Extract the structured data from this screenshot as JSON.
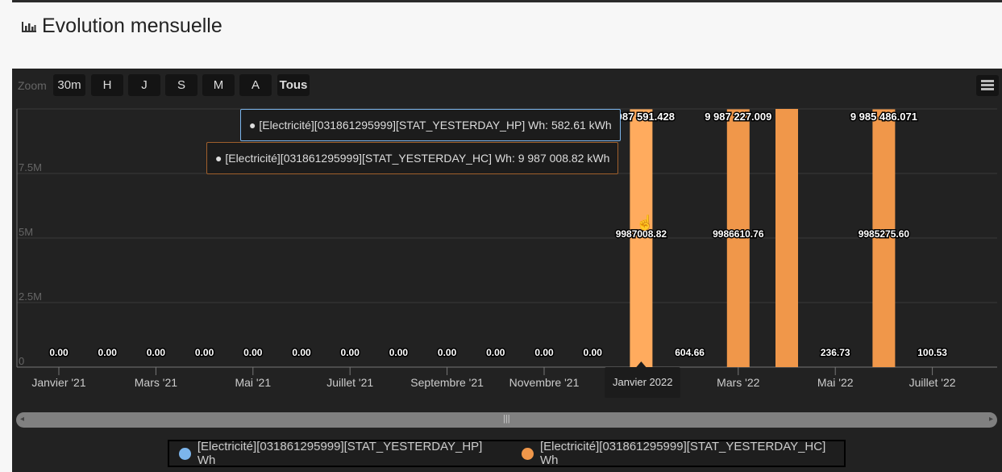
{
  "page": {
    "title": "Evolution mensuelle",
    "title_icon": "bar-chart-icon"
  },
  "toolbar": {
    "zoom_label": "Zoom",
    "buttons": [
      "30m",
      "H",
      "J",
      "S",
      "M",
      "A",
      "Tous"
    ],
    "menu_icon": "hamburger-menu-icon"
  },
  "tooltips": {
    "hp": "● [Electricité][031861295999][STAT_YESTERDAY_HP] Wh: 582.61 kWh",
    "hc": "● [Electricité][031861295999][STAT_YESTERDAY_HC] Wh: 9 987 008.82 kWh",
    "x": "Janvier 2022"
  },
  "legend": [
    {
      "label": "[Electricité][031861295999][STAT_YESTERDAY_HP] Wh",
      "color": "#7cb5ec"
    },
    {
      "label": "[Electricité][031861295999][STAT_YESTERDAY_HC] Wh",
      "color": "#f0974a"
    }
  ],
  "chart_data": {
    "type": "bar",
    "stacked": true,
    "x_ticks": [
      "Janvier '21",
      "Mars '21",
      "Mai '21",
      "Juillet '21",
      "Septembre '21",
      "Novembre '21",
      "Janvier 2022",
      "Mars '22",
      "Mai '22",
      "Juillet '22"
    ],
    "y_ticks": [
      "0",
      "2.5M",
      "5M",
      "7.5M"
    ],
    "ylim": [
      0,
      10000000
    ],
    "grid": true,
    "legend_position": "bottom",
    "categories": [
      "2021-01",
      "2021-02",
      "2021-03",
      "2021-04",
      "2021-05",
      "2021-06",
      "2021-07",
      "2021-08",
      "2021-09",
      "2021-10",
      "2021-11",
      "2021-12",
      "2022-01",
      "2022-02",
      "2022-03",
      "2022-04",
      "2022-05",
      "2022-06",
      "2022-07"
    ],
    "series": [
      {
        "name": "[Electricité][031861295999][STAT_YESTERDAY_HP] Wh",
        "color": "#7cb5ec",
        "values": [
          0,
          0,
          0,
          0,
          0,
          0,
          0,
          0,
          0,
          0,
          0,
          0,
          582.61,
          604.66,
          616.25,
          0,
          236.73,
          210.47,
          100.53
        ],
        "labels": [
          "0.00",
          "0.00",
          "0.00",
          "0.00",
          "0.00",
          "0.00",
          "0.00",
          "0.00",
          "0.00",
          "0.00",
          "0.00",
          "0.00",
          "",
          "604.66",
          "",
          "",
          "236.73",
          "",
          "100.53"
        ]
      },
      {
        "name": "[Electricité][031861295999][STAT_YESTERDAY_HC] Wh",
        "color": "#f0974a",
        "values": [
          0,
          0,
          0,
          0,
          0,
          0,
          0,
          0,
          0,
          0,
          0,
          0,
          9987008.82,
          0,
          9986610.76,
          10000000,
          0,
          9985275.6,
          0
        ],
        "labels": [
          "",
          "",
          "",
          "",
          "",
          "",
          "",
          "",
          "",
          "",
          "",
          "",
          "9987008.82",
          "",
          "9986610.76",
          "",
          "",
          "9985275.60",
          ""
        ]
      }
    ],
    "stack_labels": [
      "",
      "",
      "",
      "",
      "",
      "",
      "",
      "",
      "",
      "",
      "",
      "",
      "9 987 591.428",
      "",
      "9 987 227.009",
      "",
      "",
      "9 985 486.071",
      ""
    ],
    "hovered": "2022-01"
  }
}
